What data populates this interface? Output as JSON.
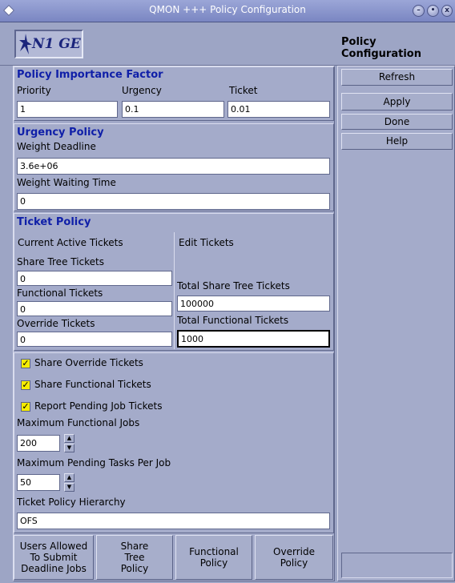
{
  "window": {
    "title": "QMON +++ Policy Configuration",
    "buttons": {
      "minimize": "–",
      "maximize": "•",
      "close": "x"
    }
  },
  "header": {
    "logo": "N1 GE",
    "page_title": "Policy Configuration"
  },
  "importance": {
    "title": "Policy Importance Factor",
    "priority_label": "Priority",
    "priority_value": "1",
    "urgency_label": "Urgency",
    "urgency_value": "0.1",
    "ticket_label": "Ticket",
    "ticket_value": "0.01"
  },
  "urgency_policy": {
    "title": "Urgency Policy",
    "weight_deadline_label": "Weight Deadline",
    "weight_deadline_value": "3.6e+06",
    "weight_waiting_label": "Weight Waiting Time",
    "weight_waiting_value": "0"
  },
  "ticket_policy": {
    "title": "Ticket Policy",
    "current_label": "Current Active Tickets",
    "edit_label": "Edit Tickets",
    "share_tree_label": "Share Tree Tickets",
    "share_tree_value": "0",
    "functional_label": "Functional Tickets",
    "functional_value": "0",
    "override_label": "Override Tickets",
    "override_value": "0",
    "total_share_label": "Total Share Tree Tickets",
    "total_share_value": "100000",
    "total_functional_label": "Total Functional Tickets",
    "total_functional_value": "1000"
  },
  "options": {
    "share_override": "Share Override Tickets",
    "share_functional": "Share Functional Tickets",
    "report_pending": "Report Pending Job Tickets",
    "max_functional_label": "Maximum Functional Jobs",
    "max_functional_value": "200",
    "max_pending_label": "Maximum Pending Tasks Per Job",
    "max_pending_value": "50",
    "hierarchy_label": "Ticket Policy Hierarchy",
    "hierarchy_value": "OFS"
  },
  "bottom_tabs": {
    "deadline": "Users Allowed To Submit Deadline Jobs",
    "share_tree": "Share Tree Policy",
    "functional": "Functional Policy",
    "override": "Override Policy"
  },
  "side_buttons": {
    "refresh": "Refresh",
    "apply": "Apply",
    "done": "Done",
    "help": "Help"
  },
  "status_text": ""
}
